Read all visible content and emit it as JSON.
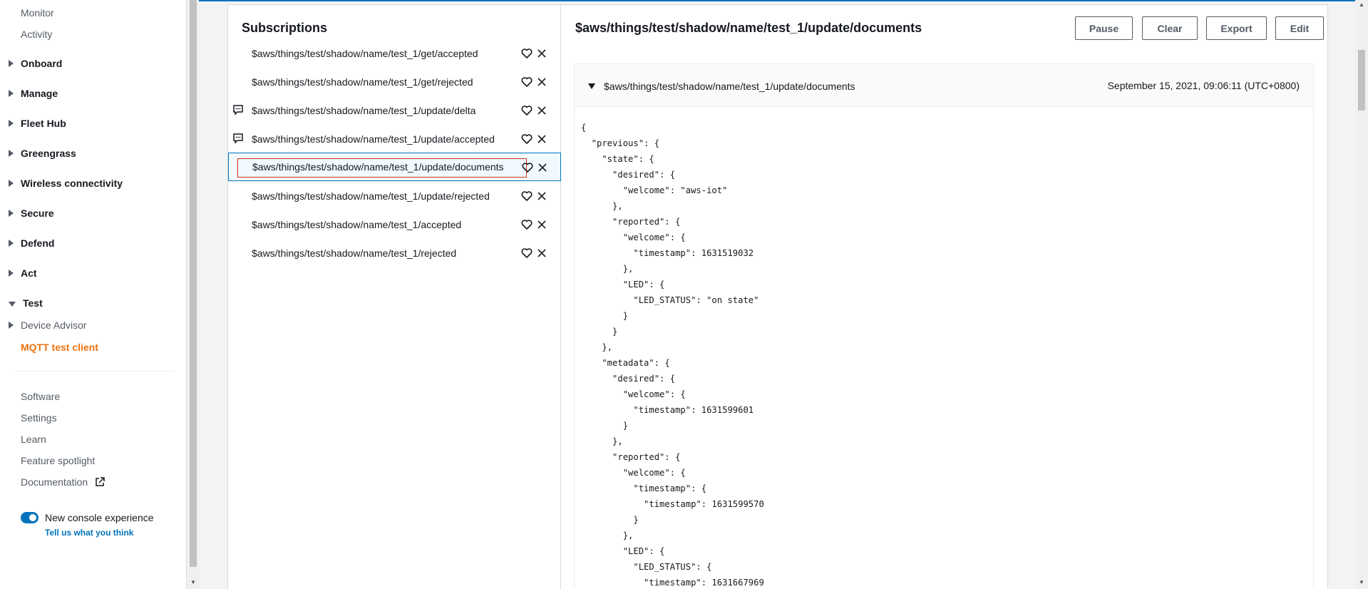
{
  "sidebar": {
    "monitor": "Monitor",
    "activity": "Activity",
    "groups": [
      "Onboard",
      "Manage",
      "Fleet Hub",
      "Greengrass",
      "Wireless connectivity",
      "Secure",
      "Defend",
      "Act"
    ],
    "test": "Test",
    "device_advisor": "Device Advisor",
    "mqtt_client": "MQTT test client",
    "links": [
      "Software",
      "Settings",
      "Learn",
      "Feature spotlight",
      "Documentation"
    ],
    "toggle_label": "New console experience",
    "feedback": "Tell us what you think"
  },
  "subscriptions": {
    "title": "Subscriptions",
    "items": [
      {
        "topic": "$aws/things/test/shadow/name/test_1/get/accepted",
        "has_msg": false
      },
      {
        "topic": "$aws/things/test/shadow/name/test_1/get/rejected",
        "has_msg": false
      },
      {
        "topic": "$aws/things/test/shadow/name/test_1/update/delta",
        "has_msg": true
      },
      {
        "topic": "$aws/things/test/shadow/name/test_1/update/accepted",
        "has_msg": true
      },
      {
        "topic": "$aws/things/test/shadow/name/test_1/update/documents",
        "has_msg": false,
        "selected": true
      },
      {
        "topic": "$aws/things/test/shadow/name/test_1/update/rejected",
        "has_msg": false
      },
      {
        "topic": "$aws/things/test/shadow/name/test_1/accepted",
        "has_msg": false
      },
      {
        "topic": "$aws/things/test/shadow/name/test_1/rejected",
        "has_msg": false
      }
    ]
  },
  "messages": {
    "title": "$aws/things/test/shadow/name/test_1/update/documents",
    "buttons": {
      "pause": "Pause",
      "clear": "Clear",
      "export": "Export",
      "edit": "Edit"
    },
    "card": {
      "topic": "$aws/things/test/shadow/name/test_1/update/documents",
      "time": "September 15, 2021, 09:06:11 (UTC+0800)",
      "payload": "{\n  \"previous\": {\n    \"state\": {\n      \"desired\": {\n        \"welcome\": \"aws-iot\"\n      },\n      \"reported\": {\n        \"welcome\": {\n          \"timestamp\": 1631519032\n        },\n        \"LED\": {\n          \"LED_STATUS\": \"on state\"\n        }\n      }\n    },\n    \"metadata\": {\n      \"desired\": {\n        \"welcome\": {\n          \"timestamp\": 1631599601\n        }\n      },\n      \"reported\": {\n        \"welcome\": {\n          \"timestamp\": {\n            \"timestamp\": 1631599570\n          }\n        },\n        \"LED\": {\n          \"LED_STATUS\": {\n            \"timestamp\": 1631667969"
    }
  },
  "colors": {
    "accent": "#0073bb",
    "active_nav": "#ec7211",
    "highlight_box": "#d13212"
  },
  "icons": [
    "caret-right-icon",
    "caret-down-icon",
    "external-link-icon",
    "message-icon",
    "heart-icon",
    "close-icon"
  ]
}
